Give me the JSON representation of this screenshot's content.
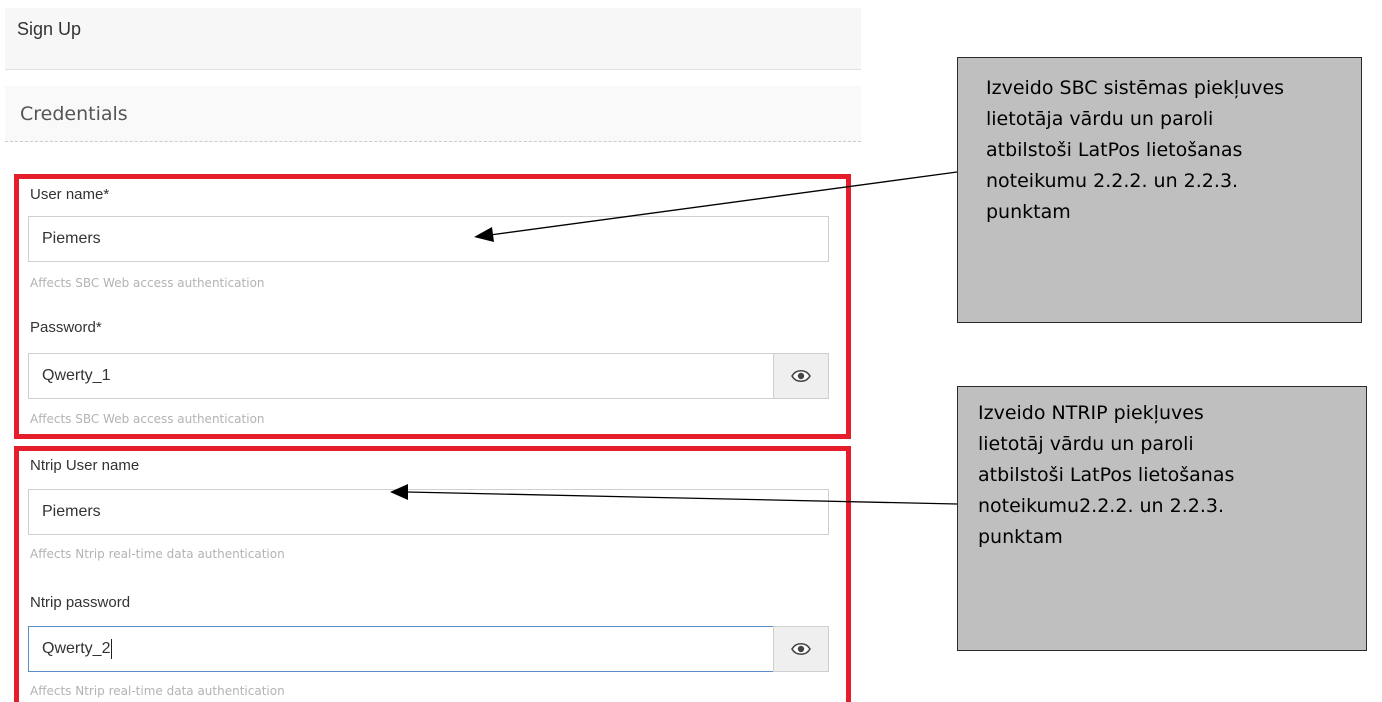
{
  "header": {
    "title": "Sign Up"
  },
  "section": {
    "title": "Credentials"
  },
  "credentials": {
    "username": {
      "label": "User name*",
      "value": "Piemers",
      "help": "Affects SBC Web access authentication"
    },
    "password": {
      "label": "Password*",
      "value": "Qwerty_1",
      "help": "Affects SBC Web access authentication"
    }
  },
  "ntrip": {
    "username": {
      "label": "Ntrip User name",
      "value": "Piemers",
      "help": "Affects Ntrip real-time data authentication"
    },
    "password": {
      "label": "Ntrip password",
      "value": "Qwerty_2",
      "help": "Affects Ntrip real-time data authentication"
    }
  },
  "icons": {
    "visibility_toggle": "eye-icon"
  },
  "colors": {
    "highlight": "#e61e2b",
    "callout_bg": "#bfbfbf",
    "focus_border": "#5b8fc9"
  },
  "callouts": {
    "sbc": {
      "lines": [
        "Izveido SBC sistēmas piekļuves",
        "lietotāja vārdu un paroli",
        "atbilstoši LatPos lietošanas",
        "noteikumu 2.2.2. un 2.2.3.",
        "punktam"
      ]
    },
    "ntrip": {
      "lines": [
        "Izveido NTRIP piekļuves",
        "lietotāj vārdu un paroli",
        "atbilstoši LatPos lietošanas",
        "noteikumu2.2.2. un 2.2.3.",
        "punktam"
      ]
    }
  }
}
